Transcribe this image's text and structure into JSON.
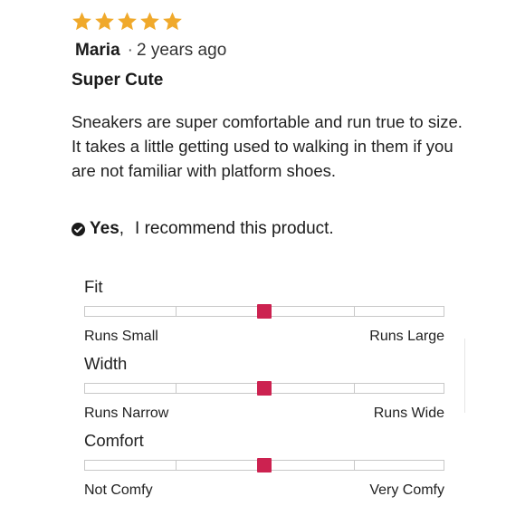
{
  "review": {
    "star_count": 5,
    "star_color": "#f0a92b",
    "author": "Maria",
    "separator": "·",
    "time_ago": "2 years ago",
    "title": "Super Cute",
    "body": "Sneakers are super comfortable and run true to size. It takes a little getting used to walking in them if you are not familiar with platform shoes.",
    "recommend_answer": "Yes",
    "recommend_comma": ",",
    "recommend_text": "I recommend this product.",
    "recommend_icon": "check-circle-icon"
  },
  "ratings": [
    {
      "label": "Fit",
      "left_end": "Runs Small",
      "right_end": "Runs Large",
      "value": 0.5
    },
    {
      "label": "Width",
      "left_end": "Runs Narrow",
      "right_end": "Runs Wide",
      "value": 0.5
    },
    {
      "label": "Comfort",
      "left_end": "Not Comfy",
      "right_end": "Very Comfy",
      "value": 0.5
    }
  ],
  "colors": {
    "marker": "#cc2250",
    "bar_border": "#c8c8c8",
    "text": "#1a1a1a"
  }
}
